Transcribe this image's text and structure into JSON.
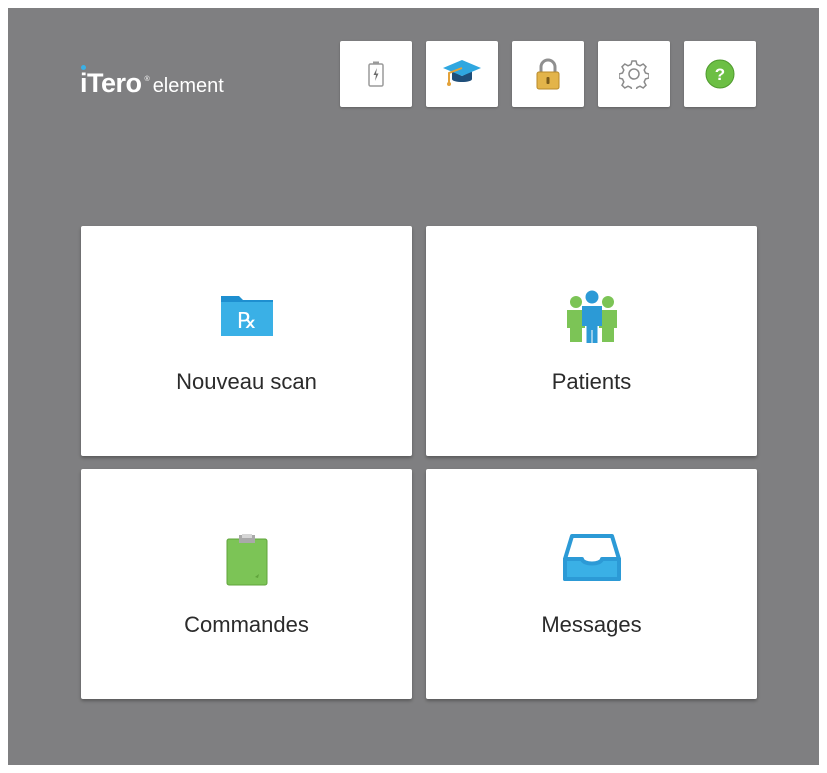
{
  "logo": {
    "brand": "iTero",
    "registered": "®",
    "product": "element"
  },
  "toolbar": [
    {
      "icon": "battery-icon"
    },
    {
      "icon": "graduation-cap-icon"
    },
    {
      "icon": "lock-icon"
    },
    {
      "icon": "gear-icon"
    },
    {
      "icon": "help-icon",
      "glyph": "?"
    }
  ],
  "tiles": {
    "new_scan": {
      "label": "Nouveau scan",
      "icon": "rx-folder-icon",
      "icon_glyph": "℞"
    },
    "patients": {
      "label": "Patients",
      "icon": "patients-group-icon"
    },
    "orders": {
      "label": "Commandes",
      "icon": "clipboard-icon"
    },
    "messages": {
      "label": "Messages",
      "icon": "inbox-tray-icon"
    }
  },
  "colors": {
    "background": "#7f7f81",
    "tile": "#ffffff",
    "accent_blue": "#3ab0e6",
    "accent_green": "#7cc456",
    "lock_gold": "#e3b44a"
  }
}
